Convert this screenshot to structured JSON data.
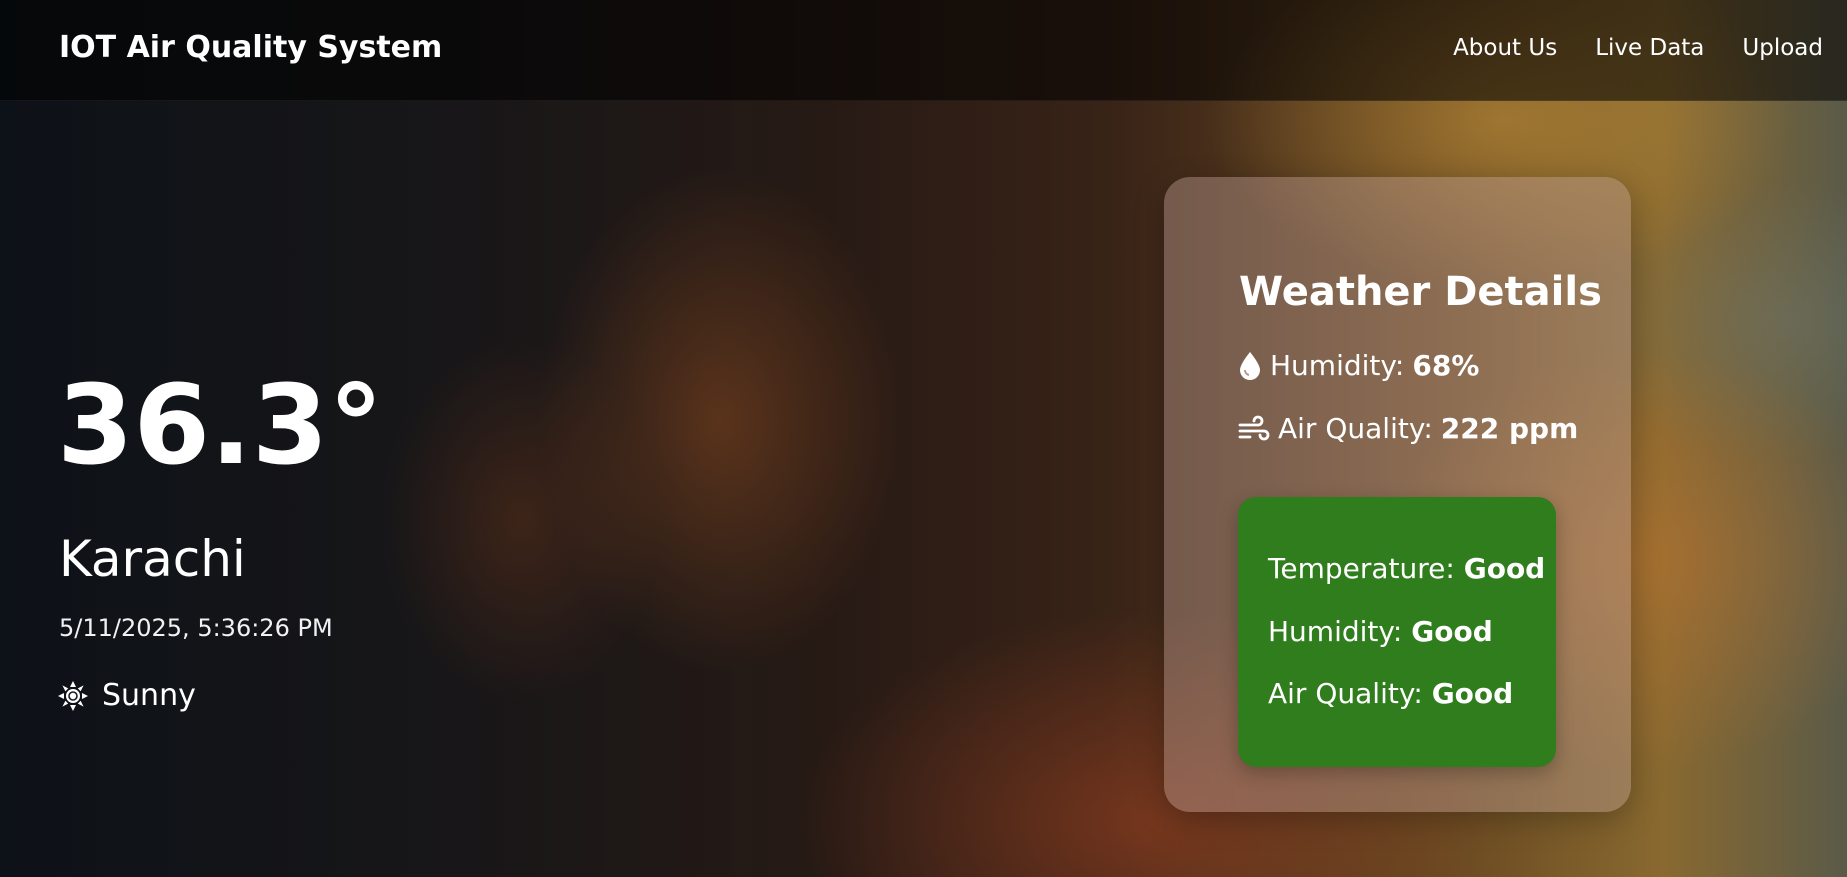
{
  "navbar": {
    "brand": "IOT Air Quality System",
    "links": [
      "About Us",
      "Live Data",
      "Upload"
    ]
  },
  "current": {
    "temperature": "36.3°",
    "city": "Karachi",
    "datetime": "5/11/2025, 5:36:26 PM",
    "condition": "Sunny",
    "condition_icon": "sun-icon"
  },
  "details": {
    "title": "Weather Details",
    "humidity_label": "Humidity:",
    "humidity_value": "68%",
    "humidity_icon": "droplet-icon",
    "air_label": "Air Quality:",
    "air_value": "222 ppm",
    "air_icon": "wind-icon"
  },
  "status": {
    "color": "#2f7d1c",
    "rows": [
      {
        "label": "Temperature:",
        "value": "Good"
      },
      {
        "label": "Humidity:",
        "value": "Good"
      },
      {
        "label": "Air Quality:",
        "value": "Good"
      }
    ]
  }
}
